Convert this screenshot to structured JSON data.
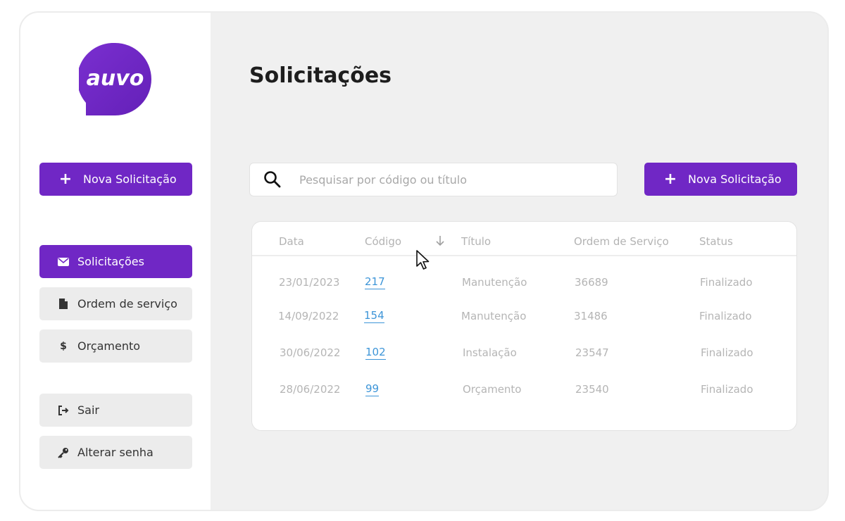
{
  "brand": {
    "logo_text": "auvo",
    "accent": "#7027c5"
  },
  "sidebar": {
    "new_request_label": "Nova Solicitação",
    "items": [
      {
        "label": "Solicitações",
        "icon": "envelope-icon",
        "active": true
      },
      {
        "label": "Ordem de serviço",
        "icon": "document-icon",
        "active": false
      },
      {
        "label": "Orçamento",
        "icon": "dollar-icon",
        "active": false
      }
    ],
    "actions": [
      {
        "label": "Sair",
        "icon": "logout-icon"
      },
      {
        "label": "Alterar senha",
        "icon": "key-icon"
      }
    ]
  },
  "main": {
    "title": "Solicitações",
    "search": {
      "placeholder": "Pesquisar por código ou título",
      "value": ""
    },
    "new_request_label": "Nova Solicitação",
    "table": {
      "columns": [
        "Data",
        "Código",
        "Título",
        "Ordem de Serviço",
        "Status"
      ],
      "sorted_column": "Código",
      "rows": [
        {
          "data": "23/01/2023",
          "codigo": "217",
          "titulo": "Manutenção",
          "ordem": "36689",
          "status": "Finalizado"
        },
        {
          "data": "14/09/2022",
          "codigo": "154",
          "titulo": "Manutenção",
          "ordem": "31486",
          "status": "Finalizado"
        },
        {
          "data": "30/06/2022",
          "codigo": "102",
          "titulo": "Instalação",
          "ordem": "23547",
          "status": "Finalizado"
        },
        {
          "data": "28/06/2022",
          "codigo": "99",
          "titulo": "Orçamento",
          "ordem": "23540",
          "status": "Finalizado"
        }
      ]
    }
  }
}
